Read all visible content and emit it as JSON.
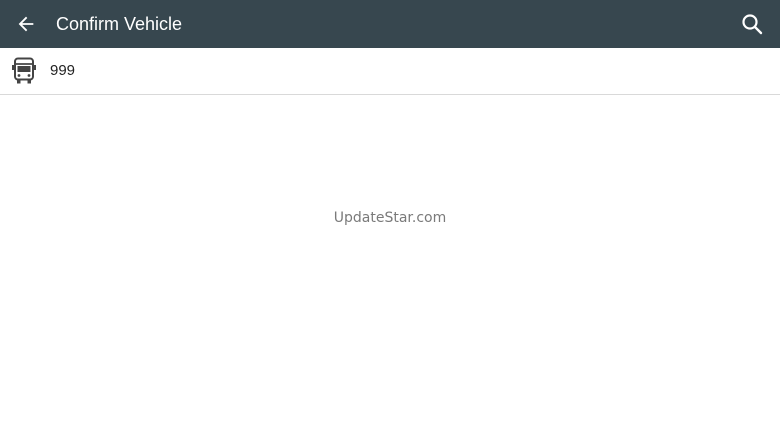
{
  "colors": {
    "toolbar_bg": "#37474f",
    "toolbar_fg": "#ffffff",
    "divider": "#d9d9d9",
    "watermark": "#7a7a7a"
  },
  "toolbar": {
    "back_icon": "arrow-left-icon",
    "title": "Confirm Vehicle",
    "search_icon": "search-icon"
  },
  "vehicles": [
    {
      "icon": "bus-icon",
      "label": "999"
    }
  ],
  "watermark": "UpdateStar.com"
}
